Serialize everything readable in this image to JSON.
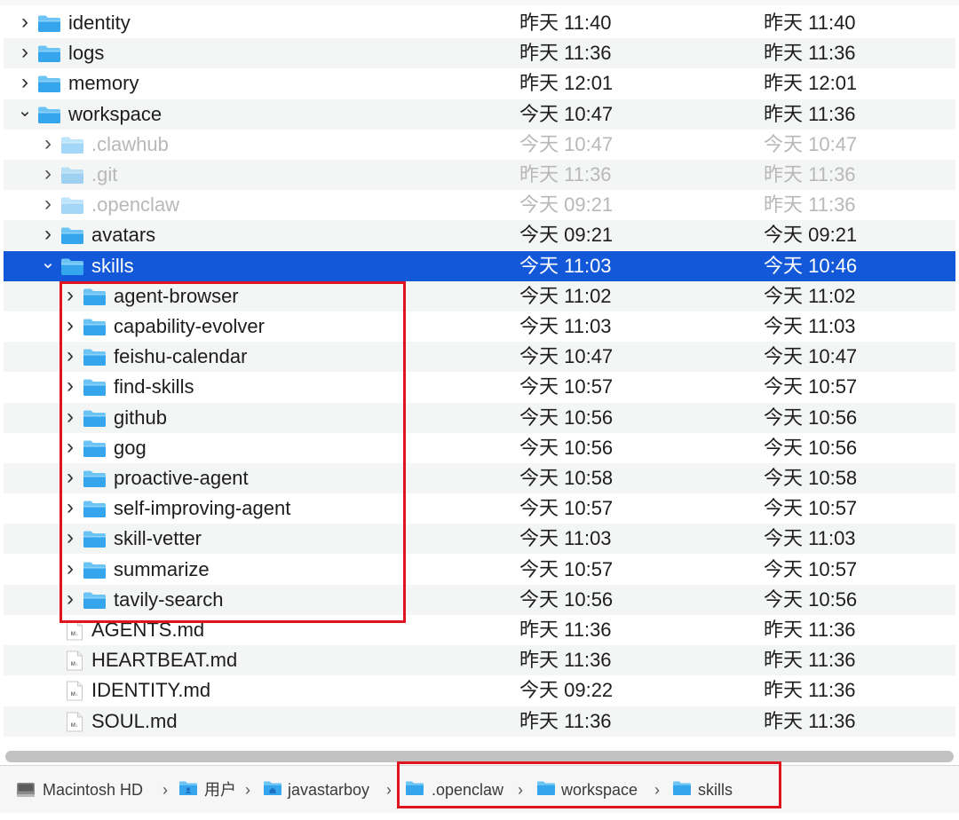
{
  "rows": [
    {
      "indent": 0,
      "disclosure": "collapsed",
      "icon": "folder",
      "name": "identity",
      "modified": "昨天 11:40",
      "created": "昨天 11:40",
      "state": "normal"
    },
    {
      "indent": 0,
      "disclosure": "collapsed",
      "icon": "folder",
      "name": "logs",
      "modified": "昨天 11:36",
      "created": "昨天 11:36",
      "state": "normal"
    },
    {
      "indent": 0,
      "disclosure": "collapsed",
      "icon": "folder",
      "name": "memory",
      "modified": "昨天 12:01",
      "created": "昨天 12:01",
      "state": "normal"
    },
    {
      "indent": 0,
      "disclosure": "expanded",
      "icon": "folder",
      "name": "workspace",
      "modified": "今天 10:47",
      "created": "昨天 11:36",
      "state": "normal"
    },
    {
      "indent": 1,
      "disclosure": "collapsed",
      "icon": "folder",
      "name": ".clawhub",
      "modified": "今天 10:47",
      "created": "今天 10:47",
      "state": "hidden"
    },
    {
      "indent": 1,
      "disclosure": "collapsed",
      "icon": "folder",
      "name": ".git",
      "modified": "昨天 11:36",
      "created": "昨天 11:36",
      "state": "hidden"
    },
    {
      "indent": 1,
      "disclosure": "collapsed",
      "icon": "folder",
      "name": ".openclaw",
      "modified": "今天 09:21",
      "created": "昨天 11:36",
      "state": "hidden"
    },
    {
      "indent": 1,
      "disclosure": "collapsed",
      "icon": "folder",
      "name": "avatars",
      "modified": "今天 09:21",
      "created": "今天 09:21",
      "state": "normal"
    },
    {
      "indent": 1,
      "disclosure": "expanded",
      "icon": "folder",
      "name": "skills",
      "modified": "今天 11:03",
      "created": "今天 10:46",
      "state": "selected"
    },
    {
      "indent": 2,
      "disclosure": "collapsed",
      "icon": "folder",
      "name": "agent-browser",
      "modified": "今天 11:02",
      "created": "今天 11:02",
      "state": "normal"
    },
    {
      "indent": 2,
      "disclosure": "collapsed",
      "icon": "folder",
      "name": "capability-evolver",
      "modified": "今天 11:03",
      "created": "今天 11:03",
      "state": "normal"
    },
    {
      "indent": 2,
      "disclosure": "collapsed",
      "icon": "folder",
      "name": "feishu-calendar",
      "modified": "今天 10:47",
      "created": "今天 10:47",
      "state": "normal"
    },
    {
      "indent": 2,
      "disclosure": "collapsed",
      "icon": "folder",
      "name": "find-skills",
      "modified": "今天 10:57",
      "created": "今天 10:57",
      "state": "normal"
    },
    {
      "indent": 2,
      "disclosure": "collapsed",
      "icon": "folder",
      "name": "github",
      "modified": "今天 10:56",
      "created": "今天 10:56",
      "state": "normal"
    },
    {
      "indent": 2,
      "disclosure": "collapsed",
      "icon": "folder",
      "name": "gog",
      "modified": "今天 10:56",
      "created": "今天 10:56",
      "state": "normal"
    },
    {
      "indent": 2,
      "disclosure": "collapsed",
      "icon": "folder",
      "name": "proactive-agent",
      "modified": "今天 10:58",
      "created": "今天 10:58",
      "state": "normal"
    },
    {
      "indent": 2,
      "disclosure": "collapsed",
      "icon": "folder",
      "name": "self-improving-agent",
      "modified": "今天 10:57",
      "created": "今天 10:57",
      "state": "normal"
    },
    {
      "indent": 2,
      "disclosure": "collapsed",
      "icon": "folder",
      "name": "skill-vetter",
      "modified": "今天 11:03",
      "created": "今天 11:03",
      "state": "normal"
    },
    {
      "indent": 2,
      "disclosure": "collapsed",
      "icon": "folder",
      "name": "summarize",
      "modified": "今天 10:57",
      "created": "今天 10:57",
      "state": "normal"
    },
    {
      "indent": 2,
      "disclosure": "collapsed",
      "icon": "folder",
      "name": "tavily-search",
      "modified": "今天 10:56",
      "created": "今天 10:56",
      "state": "normal"
    },
    {
      "indent": 1,
      "disclosure": "none",
      "icon": "markdown-file",
      "name": "AGENTS.md",
      "modified": "昨天 11:36",
      "created": "昨天 11:36",
      "state": "normal"
    },
    {
      "indent": 1,
      "disclosure": "none",
      "icon": "markdown-file",
      "name": "HEARTBEAT.md",
      "modified": "昨天 11:36",
      "created": "昨天 11:36",
      "state": "normal"
    },
    {
      "indent": 1,
      "disclosure": "none",
      "icon": "markdown-file",
      "name": "IDENTITY.md",
      "modified": "今天 09:22",
      "created": "昨天 11:36",
      "state": "normal"
    },
    {
      "indent": 1,
      "disclosure": "none",
      "icon": "markdown-file",
      "name": "SOUL.md",
      "modified": "昨天 11:36",
      "created": "昨天 11:36",
      "state": "normal"
    }
  ],
  "pathbar": {
    "items": [
      {
        "label": "Macintosh HD",
        "icon": "hard-drive-icon"
      },
      {
        "label": "用户",
        "icon": "users-folder-icon"
      },
      {
        "label": "javastarboy",
        "icon": "home-folder-icon"
      },
      {
        "label": ".openclaw",
        "icon": "folder-icon"
      },
      {
        "label": "workspace",
        "icon": "folder-icon"
      },
      {
        "label": "skills",
        "icon": "folder-icon"
      }
    ],
    "separator": "›"
  },
  "colors": {
    "selection": "#1258d8",
    "folder_top": "#6cc4f5",
    "folder_body": "#35a5ee",
    "annotation": "#e0141e",
    "alt_row": "#f4f5f5"
  }
}
